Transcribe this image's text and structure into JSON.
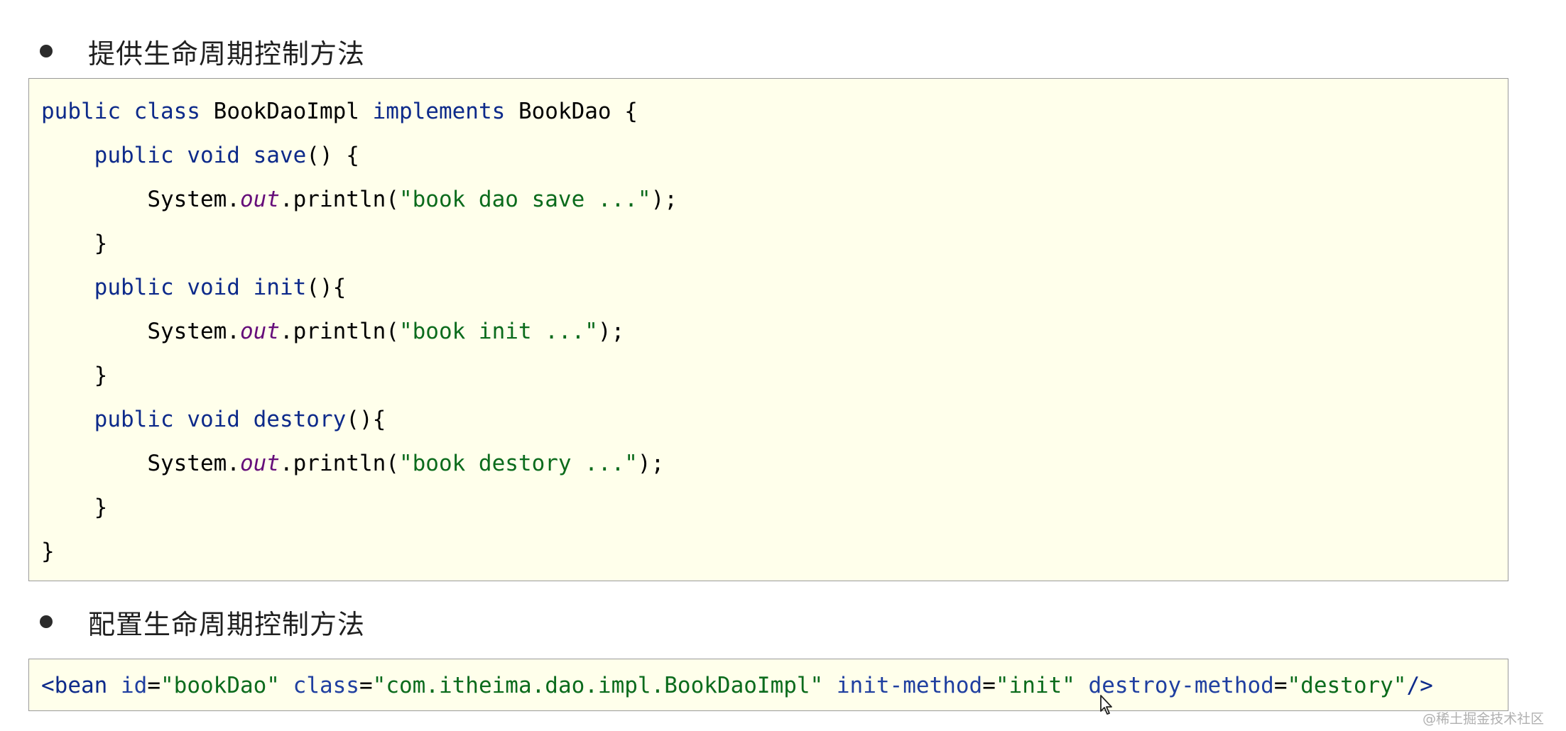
{
  "section1": {
    "heading": "提供生命周期控制方法"
  },
  "java_code": {
    "l1": {
      "kw_public": "public",
      "kw_class": "class",
      "name": "BookDaoImpl",
      "kw_implements": "implements",
      "iface": "BookDao",
      "brace": "{"
    },
    "l2": {
      "kw_public": "public",
      "kw_void": "void",
      "method": "save",
      "tail": "() {"
    },
    "l3": {
      "sys": "System.",
      "out": "out",
      "call": ".println(",
      "str": "\"book dao save ...\"",
      "end": ");"
    },
    "l4": {
      "close": "}"
    },
    "l5": {
      "kw_public": "public",
      "kw_void": "void",
      "method": "init",
      "tail": "(){"
    },
    "l6": {
      "sys": "System.",
      "out": "out",
      "call": ".println(",
      "str": "\"book init ...\"",
      "end": ");"
    },
    "l7": {
      "close": "}"
    },
    "l8": {
      "kw_public": "public",
      "kw_void": "void",
      "method": "destory",
      "tail": "(){"
    },
    "l9": {
      "sys": "System.",
      "out": "out",
      "call": ".println(",
      "str": "\"book destory ...\"",
      "end": ");"
    },
    "l10": {
      "close": "}"
    },
    "l11": {
      "close": "}"
    }
  },
  "section2": {
    "heading": "配置生命周期控制方法"
  },
  "xml_code": {
    "open": "<",
    "tag": "bean",
    "id_attr": "id",
    "id_val": "\"bookDao\"",
    "class_attr": "class",
    "class_val": "\"com.itheima.dao.impl.BookDaoImpl\"",
    "init_attr": "init-method",
    "init_val": "\"init\"",
    "destroy_attr": "destroy-method",
    "destroy_val": "\"destory\"",
    "close": "/>"
  },
  "watermark": "@稀土掘金技术社区",
  "colors": {
    "code_bg": "#ffffeb",
    "keyword": "#0d2a8a",
    "string": "#0b6b1c",
    "field": "#660e7a"
  }
}
